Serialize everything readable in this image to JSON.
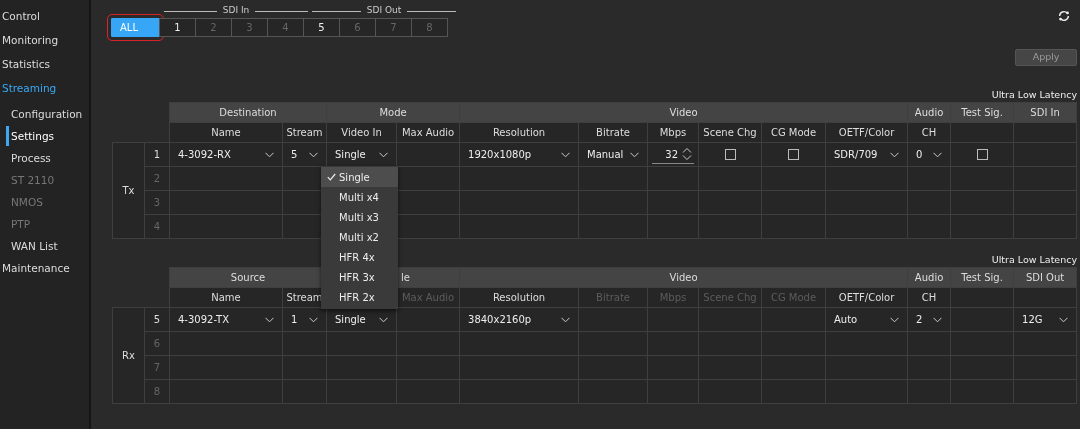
{
  "sidebar": {
    "items": [
      {
        "label": "Control",
        "selected": false,
        "disabled": false
      },
      {
        "label": "Monitoring",
        "selected": false,
        "disabled": false
      },
      {
        "label": "Statistics",
        "selected": false,
        "disabled": false
      },
      {
        "label": "Streaming",
        "selected": true,
        "disabled": false,
        "children": [
          {
            "label": "Configuration",
            "selected": false,
            "disabled": false
          },
          {
            "label": "Settings",
            "selected": true,
            "disabled": false
          },
          {
            "label": "Process",
            "selected": false,
            "disabled": false
          },
          {
            "label": "ST 2110",
            "selected": false,
            "disabled": true
          },
          {
            "label": "NMOS",
            "selected": false,
            "disabled": true
          },
          {
            "label": "PTP",
            "selected": false,
            "disabled": true
          },
          {
            "label": "WAN List",
            "selected": false,
            "disabled": false
          }
        ]
      },
      {
        "label": "Maintenance",
        "selected": false,
        "disabled": false
      }
    ]
  },
  "port_selector": {
    "groups": [
      {
        "label": "SDI In"
      },
      {
        "label": "SDI Out"
      }
    ],
    "buttons": [
      {
        "label": "ALL",
        "selected": true,
        "disabled": false,
        "highlighted": true
      },
      {
        "label": "1",
        "selected": false,
        "disabled": false,
        "highlighted": false
      },
      {
        "label": "2",
        "selected": false,
        "disabled": true,
        "highlighted": false
      },
      {
        "label": "3",
        "selected": false,
        "disabled": true,
        "highlighted": false
      },
      {
        "label": "4",
        "selected": false,
        "disabled": true,
        "highlighted": false
      },
      {
        "label": "5",
        "selected": false,
        "disabled": false,
        "highlighted": false
      },
      {
        "label": "6",
        "selected": false,
        "disabled": true,
        "highlighted": false
      },
      {
        "label": "7",
        "selected": false,
        "disabled": true,
        "highlighted": false
      },
      {
        "label": "8",
        "selected": false,
        "disabled": true,
        "highlighted": false
      }
    ]
  },
  "apply_button": {
    "label": "Apply",
    "disabled": true
  },
  "tables": [
    {
      "caption": "Ultra Low Latency",
      "direction": "Tx",
      "groups": [
        {
          "label": "Destination",
          "partially_covered": false,
          "columns": [
            {
              "label": "Name",
              "disabled": false
            },
            {
              "label": "Stream",
              "disabled": false
            }
          ]
        },
        {
          "label": "Mode",
          "partially_covered": false,
          "columns": [
            {
              "label": "Video In",
              "disabled": false
            },
            {
              "label": "Max Audio",
              "disabled": false
            }
          ]
        },
        {
          "label": "Video",
          "partially_covered": false,
          "columns": [
            {
              "label": "Resolution",
              "disabled": false
            },
            {
              "label": "Bitrate",
              "disabled": false
            },
            {
              "label": "Mbps",
              "disabled": false
            },
            {
              "label": "Scene Chg",
              "disabled": false
            },
            {
              "label": "CG Mode",
              "disabled": false
            },
            {
              "label": "OETF/Color",
              "disabled": false
            }
          ]
        },
        {
          "label": "Audio",
          "partially_covered": false,
          "columns": [
            {
              "label": "CH",
              "disabled": false
            }
          ]
        },
        {
          "label": "Test Sig.",
          "partially_covered": false,
          "columns": [
            {}
          ]
        },
        {
          "label": "SDI In",
          "partially_covered": false,
          "columns": [
            {}
          ]
        }
      ],
      "rows": [
        {
          "number": "1",
          "disabled": false,
          "cells": [
            {
              "kind": "select",
              "value": "4-3092-RX"
            },
            {
              "kind": "select",
              "value": "5"
            },
            {
              "kind": "select",
              "value": "Single",
              "open": true,
              "options": [
                {
                  "label": "Single",
                  "selected": true
                },
                {
                  "label": "Multi x4",
                  "selected": false
                },
                {
                  "label": "Multi x3",
                  "selected": false
                },
                {
                  "label": "Multi x2",
                  "selected": false
                },
                {
                  "label": "HFR 4x",
                  "selected": false
                },
                {
                  "label": "HFR 3x",
                  "selected": false
                },
                {
                  "label": "HFR 2x",
                  "selected": false
                }
              ]
            },
            {
              "kind": "empty"
            },
            {
              "kind": "select",
              "value": "1920x1080p"
            },
            {
              "kind": "select",
              "value": "Manual"
            },
            {
              "kind": "spin",
              "value": "32"
            },
            {
              "kind": "checkbox",
              "checked": false
            },
            {
              "kind": "checkbox",
              "checked": false
            },
            {
              "kind": "select",
              "value": "SDR/709"
            },
            {
              "kind": "select",
              "value": "0"
            },
            {
              "kind": "checkbox",
              "checked": false
            },
            {
              "kind": "empty"
            }
          ]
        },
        {
          "number": "2",
          "disabled": true
        },
        {
          "number": "3",
          "disabled": true
        },
        {
          "number": "4",
          "disabled": true
        }
      ]
    },
    {
      "caption": "Ultra Low Latency",
      "direction": "Rx",
      "groups": [
        {
          "label": "Source",
          "partially_covered": false,
          "columns": [
            {
              "label": "Name",
              "disabled": false
            },
            {
              "label": "Stream",
              "disabled": false
            }
          ]
        },
        {
          "label": "le",
          "partially_covered": true,
          "columns": [
            {},
            {
              "label": "Max Audio",
              "disabled": true
            }
          ]
        },
        {
          "label": "Video",
          "partially_covered": false,
          "columns": [
            {
              "label": "Resolution",
              "disabled": false
            },
            {
              "label": "Bitrate",
              "disabled": true
            },
            {
              "label": "Mbps",
              "disabled": true
            },
            {
              "label": "Scene Chg",
              "disabled": true
            },
            {
              "label": "CG Mode",
              "disabled": true
            },
            {
              "label": "OETF/Color",
              "disabled": false
            }
          ]
        },
        {
          "label": "Audio",
          "partially_covered": false,
          "columns": [
            {
              "label": "CH",
              "disabled": false
            }
          ]
        },
        {
          "label": "Test Sig.",
          "partially_covered": false,
          "columns": [
            {}
          ]
        },
        {
          "label": "SDI Out",
          "partially_covered": false,
          "columns": [
            {}
          ]
        }
      ],
      "rows": [
        {
          "number": "5",
          "disabled": false,
          "cells": [
            {
              "kind": "select",
              "value": "4-3092-TX"
            },
            {
              "kind": "select",
              "value": "1"
            },
            {
              "kind": "select",
              "value": "Single",
              "open": false
            },
            {
              "kind": "empty"
            },
            {
              "kind": "select",
              "value": "3840x2160p"
            },
            {
              "kind": "empty"
            },
            {
              "kind": "empty"
            },
            {
              "kind": "empty"
            },
            {
              "kind": "empty"
            },
            {
              "kind": "select",
              "value": "Auto"
            },
            {
              "kind": "select",
              "value": "2"
            },
            {
              "kind": "empty"
            },
            {
              "kind": "select",
              "value": "12G"
            }
          ]
        },
        {
          "number": "6",
          "disabled": true
        },
        {
          "number": "7",
          "disabled": true
        },
        {
          "number": "8",
          "disabled": true
        }
      ]
    }
  ]
}
